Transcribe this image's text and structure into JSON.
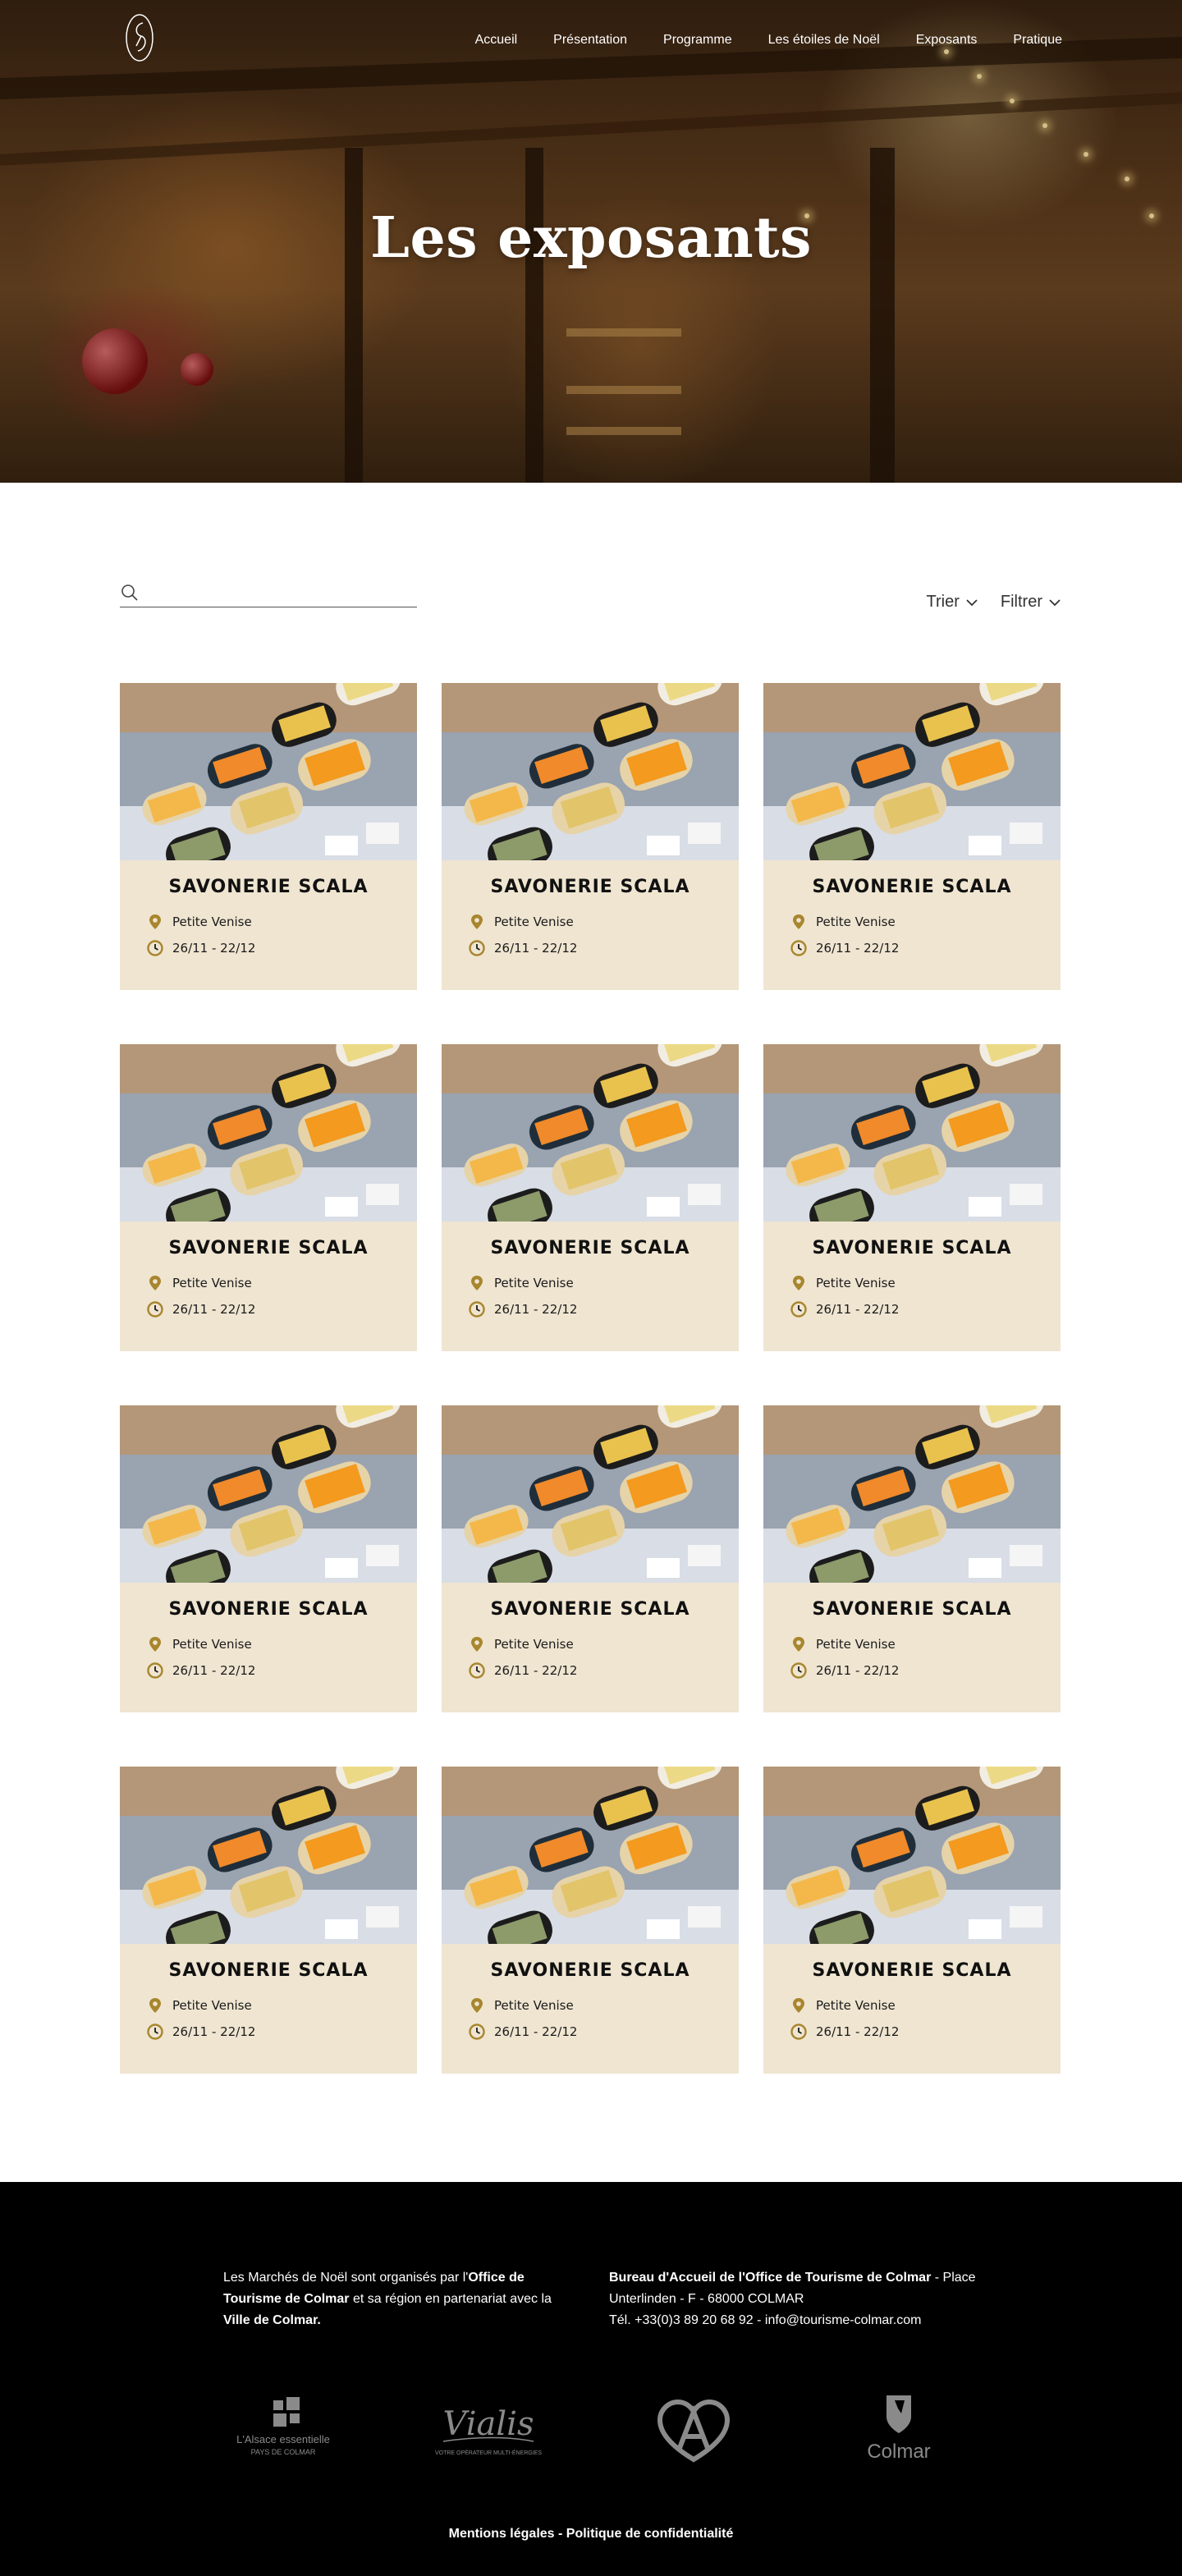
{
  "nav": {
    "items": [
      {
        "label": "Accueil"
      },
      {
        "label": "Présentation"
      },
      {
        "label": "Programme"
      },
      {
        "label": "Les étoiles de Noël"
      },
      {
        "label": "Exposants"
      },
      {
        "label": "Pratique"
      }
    ]
  },
  "hero": {
    "title": "Les exposants"
  },
  "toolbar": {
    "search_placeholder": "",
    "sort_label": "Trier",
    "filter_label": "Filtrer"
  },
  "cards": [
    {
      "name": "SAVONERIE SCALA",
      "location": "Petite Venise",
      "dates": "26/11 - 22/12"
    },
    {
      "name": "SAVONERIE SCALA",
      "location": "Petite Venise",
      "dates": "26/11 - 22/12"
    },
    {
      "name": "SAVONERIE SCALA",
      "location": "Petite Venise",
      "dates": "26/11 - 22/12"
    },
    {
      "name": "SAVONERIE SCALA",
      "location": "Petite Venise",
      "dates": "26/11 - 22/12"
    },
    {
      "name": "SAVONERIE SCALA",
      "location": "Petite Venise",
      "dates": "26/11 - 22/12"
    },
    {
      "name": "SAVONERIE SCALA",
      "location": "Petite Venise",
      "dates": "26/11 - 22/12"
    },
    {
      "name": "SAVONERIE SCALA",
      "location": "Petite Venise",
      "dates": "26/11 - 22/12"
    },
    {
      "name": "SAVONERIE SCALA",
      "location": "Petite Venise",
      "dates": "26/11 - 22/12"
    },
    {
      "name": "SAVONERIE SCALA",
      "location": "Petite Venise",
      "dates": "26/11 - 22/12"
    },
    {
      "name": "SAVONERIE SCALA",
      "location": "Petite Venise",
      "dates": "26/11 - 22/12"
    },
    {
      "name": "SAVONERIE SCALA",
      "location": "Petite Venise",
      "dates": "26/11 - 22/12"
    },
    {
      "name": "SAVONERIE SCALA",
      "location": "Petite Venise",
      "dates": "26/11 - 22/12"
    }
  ],
  "footer": {
    "left": {
      "t1": "Les Marchés de Noël sont organisés par l'",
      "b1": "Office de Tourisme de Colmar",
      "t2": " et sa région en partenariat avec la ",
      "b2": "Ville de Colmar."
    },
    "right": {
      "b1": "Bureau d'Accueil de l'Office de Tourisme de Colmar",
      "t1": " - Place Unterlinden - F - 68000 COLMAR",
      "t2": "Tél. +33(0)3 89 20 68 92 - info@tourisme-colmar.com"
    },
    "partners": {
      "alsace_line1": "L'Alsace essentielle",
      "alsace_line2": "PAYS DE COLMAR",
      "vialis_name": "Vialis",
      "vialis_tagline": "VOTRE OPÉRATEUR MULTI-ÉNERGIES",
      "colmar_name": "Colmar"
    },
    "legal_mentions": "Mentions légales",
    "legal_sep": " - ",
    "legal_privacy": "Politique de confidentialité"
  },
  "colors": {
    "card_bg": "#efe5d1",
    "accent_gold": "#a8862e",
    "footer_bg": "#000000"
  }
}
